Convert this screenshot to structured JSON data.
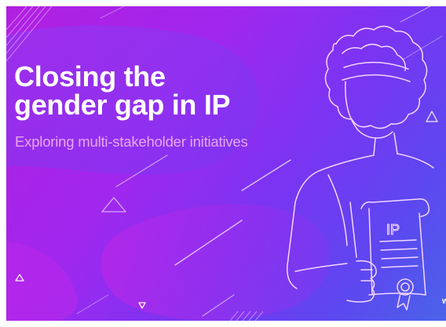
{
  "banner": {
    "title_line_1": "Closing the",
    "title_line_2": "gender gap in IP",
    "subtitle": "Exploring multi-stakeholder initiatives",
    "document_label": "IP",
    "corner_mark": "w",
    "page_dots": ". . . . . . . .",
    "colors": {
      "gradient_start": "#b11fe0",
      "gradient_mid": "#7b34f2",
      "gradient_end": "#4a63ea",
      "title": "#ffffff",
      "subtitle": "#e9a6f2",
      "line_art": "#f4d6ff"
    },
    "icons": [
      "woman-line-art-icon",
      "ip-document-scroll-icon",
      "triangle-outline-icon"
    ]
  }
}
